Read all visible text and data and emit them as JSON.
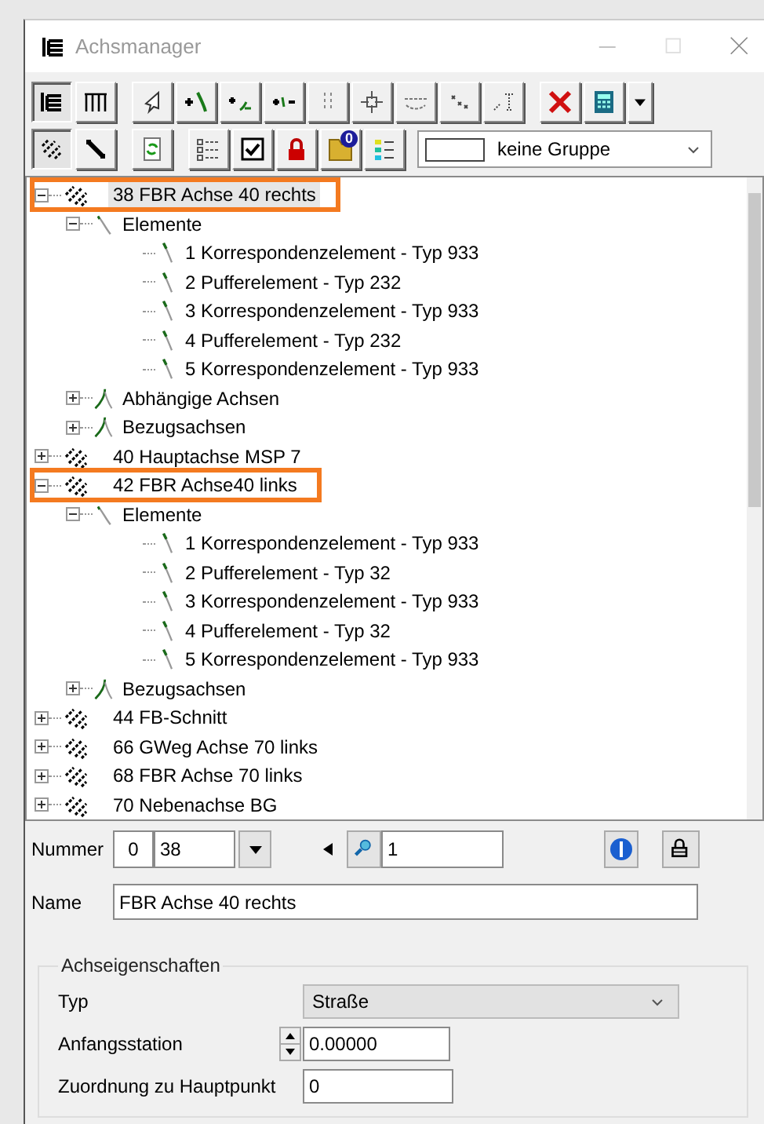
{
  "window": {
    "title": "Achsmanager"
  },
  "toolbar_rows": [
    [
      {
        "kind": "tree-view",
        "pressed": true
      },
      {
        "kind": "table-view",
        "pressed": false
      },
      {
        "kind": "cursor",
        "pressed": false
      },
      {
        "kind": "add-element",
        "pressed": false
      },
      {
        "kind": "add-after",
        "pressed": false
      },
      {
        "kind": "insert",
        "pressed": false
      },
      {
        "kind": "split",
        "pressed": false
      },
      {
        "kind": "cross",
        "pressed": false
      },
      {
        "kind": "dashed",
        "pressed": false
      },
      {
        "kind": "points",
        "pressed": false
      },
      {
        "kind": "text",
        "pressed": false
      },
      {
        "kind": "delete",
        "pressed": false
      },
      {
        "kind": "calculator",
        "pressed": false
      },
      {
        "kind": "dropdown",
        "pressed": false
      }
    ],
    [
      {
        "kind": "axis-view",
        "pressed": true
      },
      {
        "kind": "element-view",
        "pressed": false
      },
      {
        "kind": "refresh",
        "pressed": false
      },
      {
        "kind": "list",
        "pressed": false
      },
      {
        "kind": "checkbox",
        "pressed": false
      },
      {
        "kind": "lock",
        "pressed": false
      },
      {
        "kind": "folder",
        "pressed": false,
        "badge": "0"
      },
      {
        "kind": "colors",
        "pressed": false
      }
    ]
  ],
  "group_select": {
    "value": "keine Gruppe"
  },
  "tree": [
    {
      "kind": "axis",
      "label": "38 FBR Achse 40 rechts",
      "expanded": true,
      "selected": true,
      "highlighted": true,
      "children": [
        {
          "kind": "group",
          "label": "Elemente",
          "expanded": true,
          "selected": false,
          "children": [
            {
              "kind": "element",
              "label": "1 Korrespondenzelement - Typ 933",
              "selected": false
            },
            {
              "kind": "element",
              "label": "2 Pufferelement - Typ 232",
              "selected": false
            },
            {
              "kind": "element",
              "label": "3 Korrespondenzelement - Typ 933",
              "selected": false
            },
            {
              "kind": "element",
              "label": "4 Pufferelement - Typ 232",
              "selected": false
            },
            {
              "kind": "element",
              "label": "5 Korrespondenzelement - Typ 933",
              "selected": false
            }
          ]
        },
        {
          "kind": "link",
          "label": "Abhängige Achsen",
          "expanded": false,
          "selected": false
        },
        {
          "kind": "link",
          "label": "Bezugsachsen",
          "expanded": false,
          "selected": false
        }
      ]
    },
    {
      "kind": "axis",
      "label": "40 Hauptachse MSP 7",
      "expanded": false,
      "selected": false,
      "highlighted": false
    },
    {
      "kind": "axis",
      "label": "42 FBR Achse40 links",
      "expanded": true,
      "selected": false,
      "highlighted": true,
      "children": [
        {
          "kind": "group",
          "label": "Elemente",
          "expanded": true,
          "selected": false,
          "children": [
            {
              "kind": "element",
              "label": "1 Korrespondenzelement - Typ 933",
              "selected": false
            },
            {
              "kind": "element",
              "label": "2 Pufferelement - Typ 32",
              "selected": false
            },
            {
              "kind": "element",
              "label": "3 Korrespondenzelement - Typ 933",
              "selected": false
            },
            {
              "kind": "element",
              "label": "4 Pufferelement - Typ 32",
              "selected": false
            },
            {
              "kind": "element",
              "label": "5 Korrespondenzelement - Typ 933",
              "selected": false
            }
          ]
        },
        {
          "kind": "link",
          "label": "Bezugsachsen",
          "expanded": false,
          "selected": false
        }
      ]
    },
    {
      "kind": "axis",
      "label": "44 FB-Schnitt",
      "expanded": false,
      "selected": false,
      "highlighted": false
    },
    {
      "kind": "axis",
      "label": "66 GWeg Achse 70 links",
      "expanded": false,
      "selected": false,
      "highlighted": false
    },
    {
      "kind": "axis",
      "label": "68 FBR Achse 70 links",
      "expanded": false,
      "selected": false,
      "highlighted": false
    },
    {
      "kind": "axis",
      "label": "70 Nebenachse BG",
      "expanded": false,
      "selected": false,
      "highlighted": false
    }
  ],
  "nummer": {
    "label": "Nummer",
    "prefix": "0",
    "value": "38",
    "search_value": "1"
  },
  "name": {
    "label": "Name",
    "value": "FBR Achse 40 rechts"
  },
  "properties": {
    "title": "Achseigenschaften",
    "typ": {
      "label": "Typ",
      "value": "Straße"
    },
    "anfangsstation": {
      "label": "Anfangsstation",
      "value": "0.00000"
    },
    "zuordnung": {
      "label": "Zuordnung zu Hauptpunkt",
      "value": "0"
    }
  }
}
